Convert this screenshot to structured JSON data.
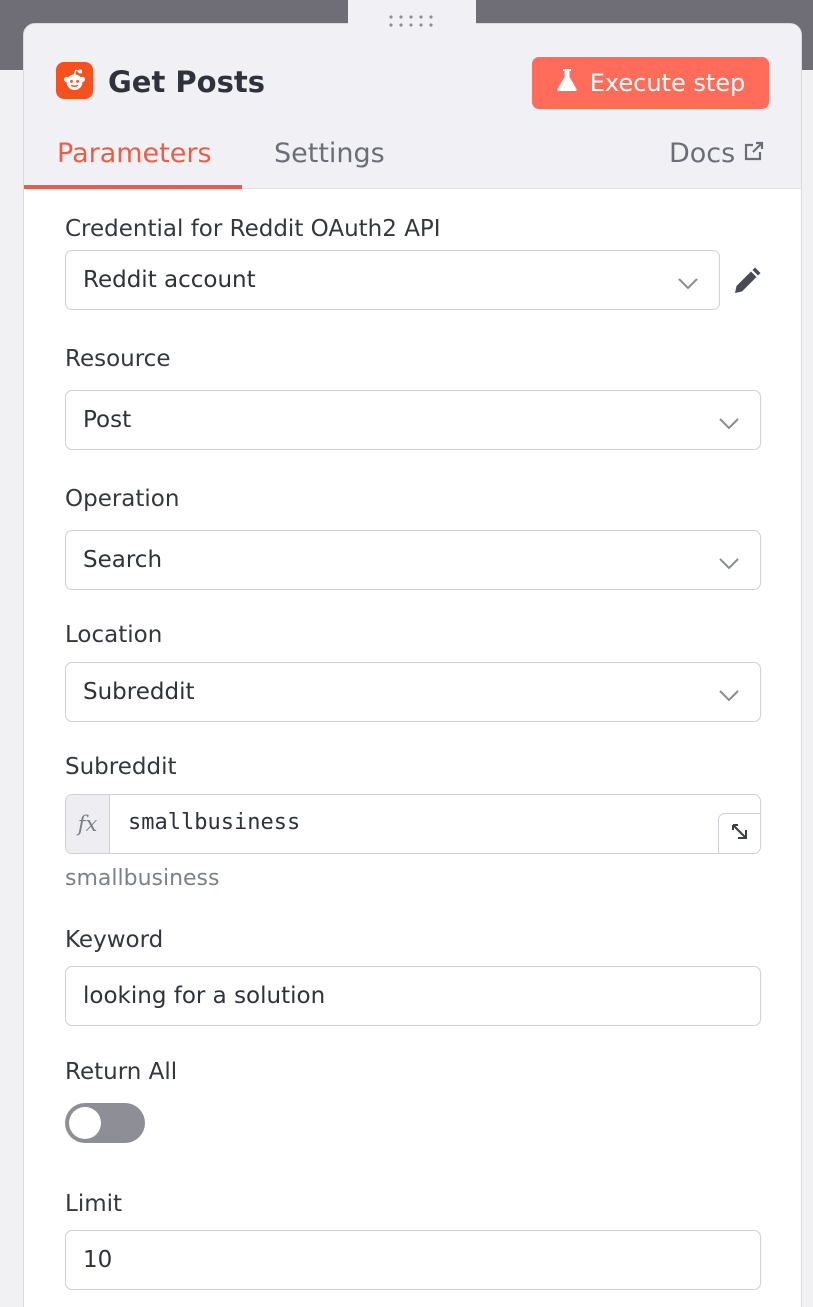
{
  "node": {
    "title": "Get Posts",
    "icon": "reddit-icon",
    "execute_label": "Execute step"
  },
  "tabs": {
    "parameters": "Parameters",
    "settings": "Settings",
    "docs": "Docs",
    "active": "Parameters"
  },
  "fields": {
    "credential": {
      "label": "Credential for Reddit OAuth2 API",
      "value": "Reddit account"
    },
    "resource": {
      "label": "Resource",
      "value": "Post"
    },
    "operation": {
      "label": "Operation",
      "value": "Search"
    },
    "location": {
      "label": "Location",
      "value": "Subreddit"
    },
    "subreddit": {
      "label": "Subreddit",
      "value": "smallbusiness",
      "fx": "fx",
      "hint": "smallbusiness"
    },
    "keyword": {
      "label": "Keyword",
      "value": "looking for a solution"
    },
    "return_all": {
      "label": "Return All",
      "enabled": false
    },
    "limit": {
      "label": "Limit",
      "value": "10"
    }
  },
  "colors": {
    "accent": "#ff6d5a",
    "tab_active": "#ea5e48",
    "reddit": "#f4511e"
  }
}
